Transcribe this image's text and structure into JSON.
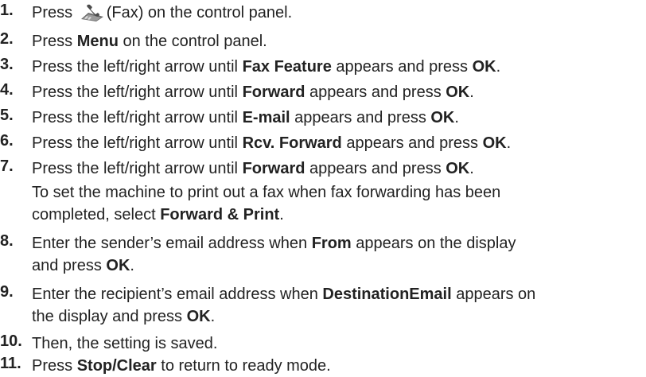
{
  "steps": [
    {
      "num": "1.",
      "a": "Press ",
      "icon": "fax-icon",
      "b": "(Fax) on the control panel."
    },
    {
      "num": "2.",
      "a": "Press ",
      "b1": "Menu",
      "c": " on the control panel."
    },
    {
      "num": "3.",
      "a": "Press the left/right arrow until ",
      "b1": "Fax Feature",
      "c": " appears and press ",
      "b2": "OK",
      "d": "."
    },
    {
      "num": "4.",
      "a": "Press the left/right arrow until ",
      "b1": "Forward",
      "c": " appears and press ",
      "b2": "OK",
      "d": "."
    },
    {
      "num": "5.",
      "a": "Press the left/right arrow until ",
      "b1": "E-mail",
      "c": " appears and press ",
      "b2": "OK",
      "d": "."
    },
    {
      "num": "6.",
      "a": "Press the left/right arrow until ",
      "b1": "Rcv. Forward",
      "c": " appears and press ",
      "b2": "OK",
      "d": "."
    },
    {
      "num": "7.",
      "a": "Press the left/right arrow until ",
      "b1": "Forward",
      "c": " appears and press ",
      "b2": "OK",
      "d": ".",
      "note1": "To set the machine to print out a fax when fax forwarding has been",
      "note2a": "completed, select ",
      "note2b": "Forward & Print",
      "note2c": "."
    },
    {
      "num": "8.",
      "a": "Enter the sender’s email address when ",
      "b1": "From",
      "c": " appears on the display",
      "l2a": "and press ",
      "l2b": "OK",
      "l2c": "."
    },
    {
      "num": "9.",
      "a": "Enter the recipient’s email address when ",
      "b1": "DestinationEmail",
      "c": " appears on",
      "l2a": "the display and press ",
      "l2b": "OK",
      "l2c": "."
    },
    {
      "num": "10.",
      "a": "Then, the setting is saved."
    },
    {
      "num": "11.",
      "a": "Press ",
      "b1": "Stop/Clear",
      "c": " to return to ready mode."
    }
  ]
}
